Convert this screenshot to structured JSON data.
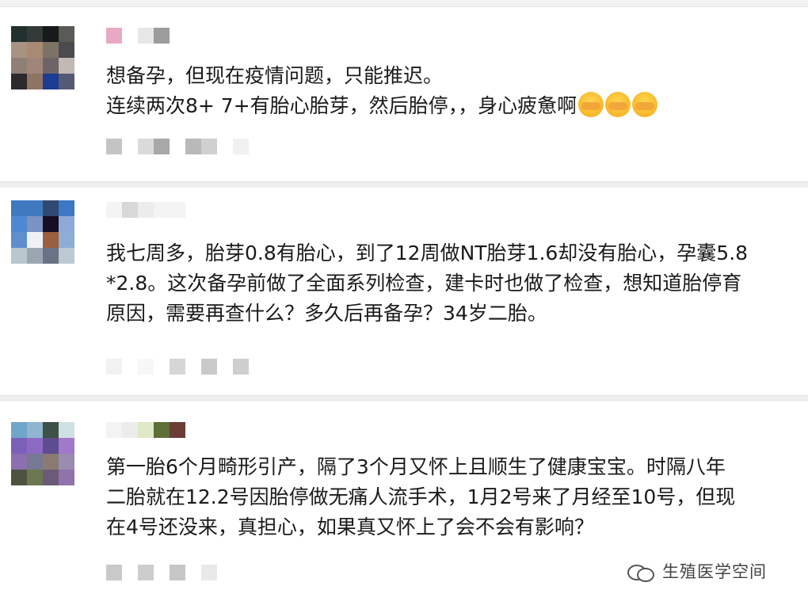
{
  "comments": [
    {
      "avatar": [
        "#23302d",
        "#343a38",
        "#171a1a",
        "#5a5a56",
        "#a89281",
        "#a88a74",
        "#7c7366",
        "#4a4a4f",
        "#8f7f75",
        "#a08678",
        "#6e6366",
        "#c2b9b5",
        "#2c2a2c",
        "#8e7465",
        "#1c3b92",
        "#545a75"
      ],
      "name_pixels": [
        "#e9a9c4",
        "#ffffff",
        "#e7e7e7",
        "#9c9c9c"
      ],
      "text": [
        "想备孕，但现在疫情问题，只能推迟。",
        "连续两次8+ 7+有胎心胎芽，然后胎停，，身心疲惫啊"
      ],
      "emoji_count": 3,
      "emoji_icon": "crying-face-emoji-icon",
      "meta_pixels": [
        "#c4c4c4",
        "#ffffff",
        "#dadada",
        "#a8a8a8",
        "#ffffff",
        "#b9b9b9",
        "#d0d0d0",
        "#ffffff",
        "#f1f1f1"
      ]
    },
    {
      "avatar": [
        "#3f7ac0",
        "#3f7ac0",
        "#2f4a70",
        "#3c78c4",
        "#4d88d1",
        "#7a93c2",
        "#170d24",
        "#8faad8",
        "#5f8ecd",
        "#eef1f8",
        "#9b5f3e",
        "#8dadd5",
        "#b9c7cf",
        "#9aa7b3",
        "#6b7285",
        "#bcc8d2"
      ],
      "name_pixels": [
        "#f4f4f4",
        "#d8d8d8",
        "#ececec",
        "#f4f4f4",
        "#f4f4f4"
      ],
      "text": [
        "我七周多，胎芽0.8有胎心，到了12周做NT胎芽1.6却没有胎心，孕囊5.8",
        "*2.8。这次备孕前做了全面系列检查，建卡时也做了检查，想知道胎停育",
        "原因，需要再查什么？多久后再备孕？34岁二胎。"
      ],
      "meta_pixels": [
        "#f2f2f2",
        "#ffffff",
        "#f7f7f7",
        "#ffffff",
        "#d6d6d6",
        "#ffffff",
        "#c9c9c9",
        "#ffffff",
        "#cfcfcf"
      ]
    },
    {
      "avatar": [
        "#6fa6c9",
        "#8fb5cf",
        "#3d5147",
        "#cfe0e3",
        "#7b5fb9",
        "#8d6ac1",
        "#5d4c8f",
        "#a278c9",
        "#8b6fae",
        "#777891",
        "#8a7a72",
        "#9a8cb0",
        "#4c5440",
        "#6c7651",
        "#6c5b78",
        "#8f73aa"
      ],
      "name_pixels": [
        "#f3f3f3",
        "#ececec",
        "#dfe8c8",
        "#5d6e38",
        "#6b3d36"
      ],
      "text": [
        "第一胎6个月畸形引产，隔了3个月又怀上且顺生了健康宝宝。时隔八年",
        "二胎就在12.2号因胎停做无痛人流手术，1月2号来了月经至10号，但现",
        "在4号还没来，真担心，如果真又怀上了会不会有影响？"
      ],
      "meta_pixels": [
        "#c9c9c9",
        "#ffffff",
        "#cdcdcd",
        "#ffffff",
        "#c6c6c6",
        "#ffffff",
        "#e9e9e9"
      ]
    }
  ],
  "watermark": {
    "label": "生殖医学空间",
    "icon": "wechat-official-account-icon"
  }
}
